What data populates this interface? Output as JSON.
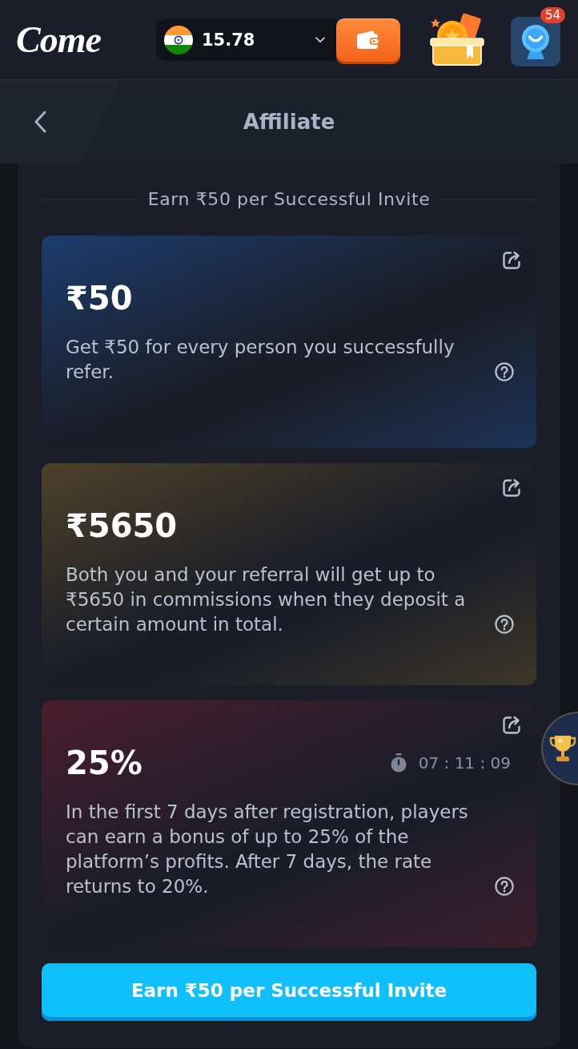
{
  "header": {
    "logo": "Come",
    "balance": "15.78",
    "notification_count": "54"
  },
  "nav": {
    "title": "Affiliate"
  },
  "section_title": "Earn ₹50 per Successful Invite",
  "cards": [
    {
      "amount": "₹50",
      "description": "Get ₹50 for every person you successfully refer.",
      "color": "#1c3d6e"
    },
    {
      "amount": "₹5650",
      "description": "Both you and your referral will get up to ₹5650 in commissions when they deposit a certain amount in total.",
      "color": "#4d4128"
    },
    {
      "amount": "25%",
      "timer": "07 : 11 : 09",
      "description": "In the first 7 days after registration, players can earn a bonus of up to 25% of the platform’s profits. After 7 days, the rate returns to 20%.",
      "color": "#4b1d2d"
    }
  ],
  "invite_button": "Earn ₹50 per Successful Invite"
}
